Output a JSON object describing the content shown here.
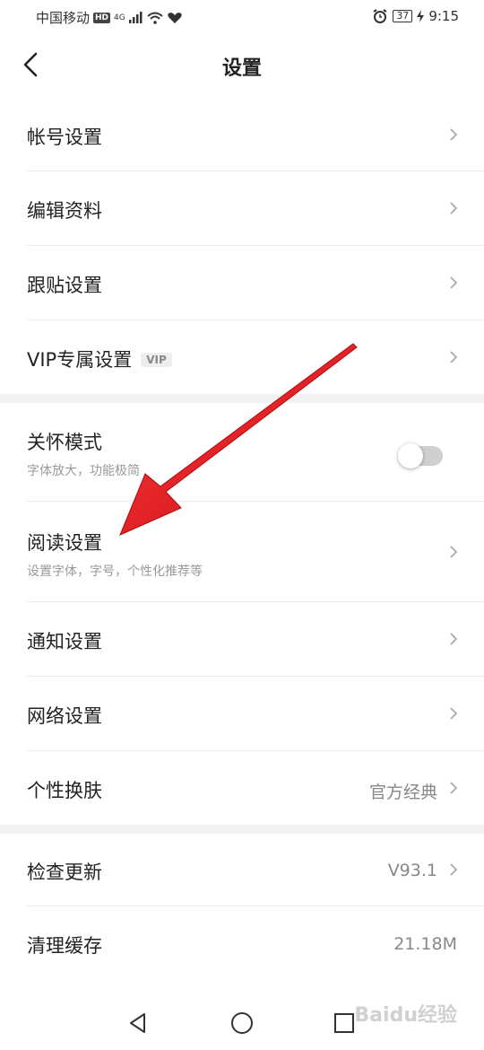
{
  "status_bar": {
    "carrier": "中国移动",
    "hd": "HD",
    "network": "4G",
    "battery": "37",
    "time": "9:15"
  },
  "header": {
    "title": "设置"
  },
  "items": [
    {
      "label": "帐号设置"
    },
    {
      "label": "编辑资料"
    },
    {
      "label": "跟贴设置"
    },
    {
      "label": "VIP专属设置",
      "badge": "VIP"
    },
    {
      "label": "关怀模式",
      "subtitle": "字体放大，功能极简",
      "toggle": false
    },
    {
      "label": "阅读设置",
      "subtitle": "设置字体，字号，个性化推荐等"
    },
    {
      "label": "通知设置"
    },
    {
      "label": "网络设置"
    },
    {
      "label": "个性换肤",
      "value": "官方经典"
    },
    {
      "label": "检查更新",
      "value": "V93.1"
    },
    {
      "label": "清理缓存",
      "value": "21.18M"
    }
  ],
  "colors": {
    "annotation_arrow": "#e8121b",
    "divider": "#ececec",
    "section_gap": "#f2f2f2"
  },
  "watermark": "Baidu经验"
}
